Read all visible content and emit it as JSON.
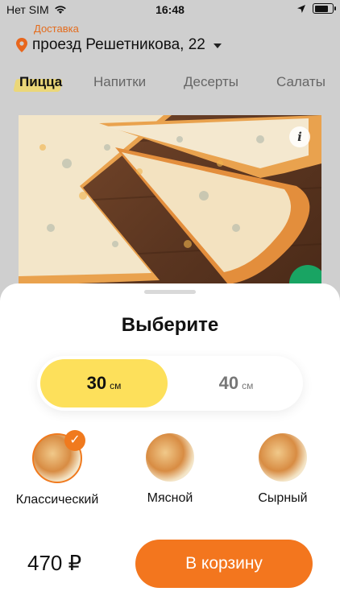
{
  "status_bar": {
    "carrier": "Нет SIM",
    "time": "16:48",
    "battery_level": 0.92
  },
  "header": {
    "delivery_label": "Доставка",
    "address": "проезд Решетникова, 22"
  },
  "tabs": [
    {
      "label": "Пицца",
      "active": true
    },
    {
      "label": "Напитки",
      "active": false
    },
    {
      "label": "Десерты",
      "active": false
    },
    {
      "label": "Салаты",
      "active": false
    }
  ],
  "product_card": {
    "info_icon": "info-icon",
    "info_glyph": "i",
    "badge_icon": "leaf-icon"
  },
  "sheet": {
    "title": "Выберите",
    "sizes": [
      {
        "value": "30",
        "unit": "см",
        "selected": true
      },
      {
        "value": "40",
        "unit": "см",
        "selected": false
      }
    ],
    "crusts": [
      {
        "label": "Классический",
        "selected": true
      },
      {
        "label": "Мясной",
        "selected": false
      },
      {
        "label": "Сырный",
        "selected": false
      }
    ],
    "check_glyph": "✓",
    "price": "470 ₽",
    "cart_button": "В корзину"
  },
  "colors": {
    "accent_orange": "#f3761e",
    "size_selected": "#fde05b",
    "delivery_text": "#e46c1d",
    "badge_green": "#19a463"
  }
}
